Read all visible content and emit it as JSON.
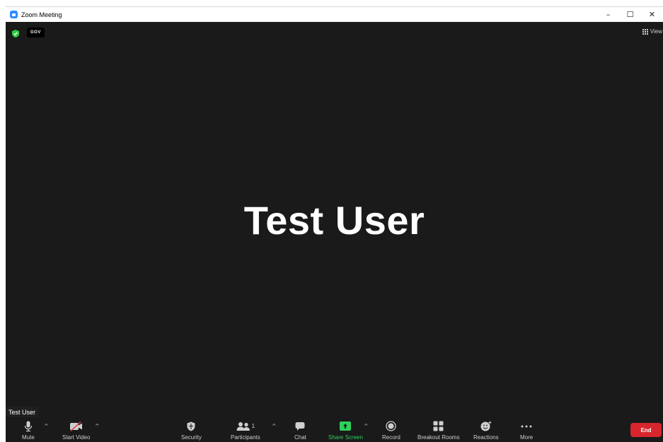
{
  "window": {
    "title": "Zoom Meeting",
    "minimize": "–",
    "maximize": "☐",
    "close": "✕"
  },
  "meeting": {
    "badge": "GOV",
    "view_label": "View",
    "participant_name": "Test User",
    "name_tag": "Test User"
  },
  "toolbar": {
    "mute": "Mute",
    "start_video": "Start Video",
    "security": "Security",
    "participants": "Participants",
    "participants_count": "1",
    "chat": "Chat",
    "share_screen": "Share Screen",
    "record": "Record",
    "breakout_rooms": "Breakout Rooms",
    "reactions": "Reactions",
    "more": "More",
    "end": "End",
    "caret": "^"
  },
  "colors": {
    "stage_bg": "#1a1a1a",
    "share_green": "#2ed15c",
    "end_red": "#d7262c",
    "shield_green": "#2ecc40",
    "zoom_blue": "#2d8cff"
  },
  "icons": {
    "app": "zoom-logo-icon",
    "encryption": "shield-check-icon",
    "view": "grid-icon",
    "mute": "microphone-icon",
    "video": "video-off-icon",
    "security": "shield-icon",
    "participants": "people-icon",
    "chat": "chat-bubble-icon",
    "share": "share-screen-icon",
    "record": "record-icon",
    "breakout": "breakout-grid-icon",
    "reactions": "smiley-plus-icon",
    "more": "ellipsis-icon"
  }
}
